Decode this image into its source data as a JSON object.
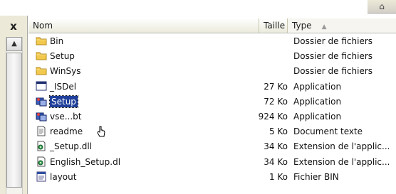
{
  "header": {
    "name_label": "Nom",
    "size_label": "Taille",
    "type_label": "Type",
    "sort_indicator": "▲"
  },
  "window": {
    "close_label": "x",
    "scroll_up": "▲",
    "corner_glyph": "⌂"
  },
  "files": [
    {
      "name": "Bin",
      "size": "",
      "type": "Dossier de fichiers",
      "icon": "folder-icon"
    },
    {
      "name": "Setup",
      "size": "",
      "type": "Dossier de fichiers",
      "icon": "folder-icon"
    },
    {
      "name": "WinSys",
      "size": "",
      "type": "Dossier de fichiers",
      "icon": "folder-icon"
    },
    {
      "name": "_ISDel",
      "size": "27 Ko",
      "type": "Application",
      "icon": "application-window-icon"
    },
    {
      "name": "Setup",
      "size": "72 Ko",
      "type": "Application",
      "icon": "setup-application-icon",
      "selected": true
    },
    {
      "name": "vse...bt",
      "size": "924 Ko",
      "type": "Application",
      "icon": "setup-application-icon"
    },
    {
      "name": "readme",
      "size": "5 Ko",
      "type": "Document texte",
      "icon": "text-document-icon"
    },
    {
      "name": "_Setup.dll",
      "size": "34 Ko",
      "type": "Extension de l'applic...",
      "icon": "dll-file-icon"
    },
    {
      "name": "English_Setup.dl",
      "size": "34 Ko",
      "type": "Extension de l'applic...",
      "icon": "dll-file-icon"
    },
    {
      "name": "layout",
      "size": "1 Ko",
      "type": "Fichier BIN",
      "icon": "bin-file-icon"
    }
  ],
  "colors": {
    "selection": "#1f3f9a",
    "folder": "#f2c94c",
    "header_bg": "#ebeadb"
  }
}
